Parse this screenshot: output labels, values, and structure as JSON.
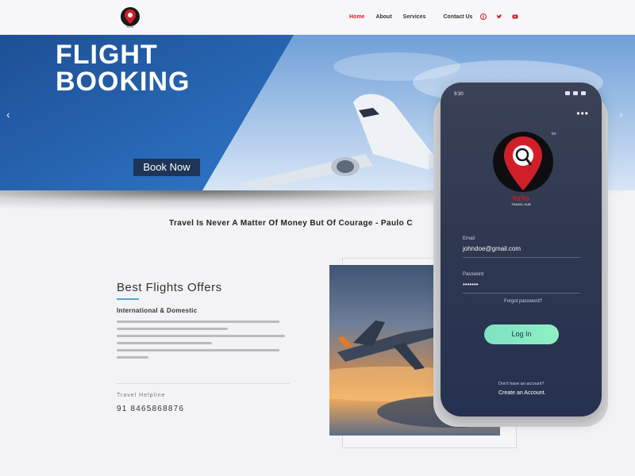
{
  "nav": {
    "items": [
      "Home",
      "About",
      "Services",
      "Contact Us"
    ],
    "active_index": 0,
    "accent_color": "#d11f2a",
    "social_icons": [
      "facebook-icon",
      "twitter-icon",
      "youtube-icon"
    ]
  },
  "hero": {
    "title_line1": "FLIGHT",
    "title_line2": "BOOKING",
    "cta_label": "Book Now",
    "prev_arrow": "‹",
    "next_arrow": "›"
  },
  "quote": "Travel Is Never A Matter Of Money But Of Courage - Paulo C",
  "offers": {
    "title": "Best Flights Offers",
    "subtitle": "International & Domestic",
    "contact_label": "Travel Helpline",
    "phone": "91 8465868876"
  },
  "app": {
    "status_time": "9:30",
    "logo_text": "YoYo",
    "logo_tagline": "TRAVEL HUB",
    "trademark": "tm",
    "email_label": "Email",
    "email_value": "johndoe@gmail.com",
    "password_label": "Password",
    "password_value": "•••••••",
    "forgot_label": "Forgot password?",
    "login_label": "Log In",
    "no_account_text": "Don't have an account?",
    "create_account_label": "Create an Account."
  },
  "colors": {
    "brand_red": "#d11f2a",
    "hero_blue": "#1f5da8",
    "button_dark": "#1d3557",
    "phone_bg": "#2f3850",
    "login_green": "#86e9c3"
  }
}
